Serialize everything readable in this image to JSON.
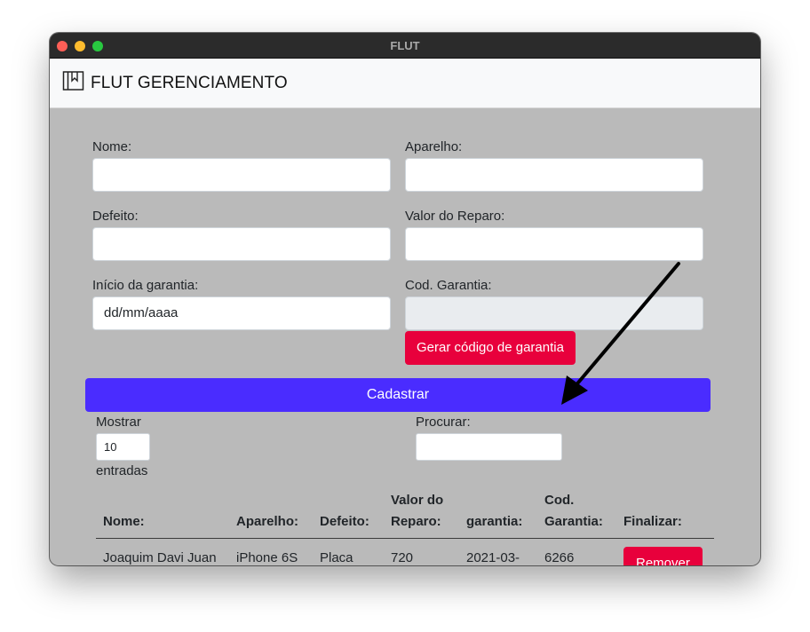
{
  "window": {
    "title": "FLUT"
  },
  "navbar": {
    "brand": "FLUT GERENCIAMENTO"
  },
  "form": {
    "nome_label": "Nome:",
    "aparelho_label": "Aparelho:",
    "defeito_label": "Defeito:",
    "valor_label": "Valor do Reparo:",
    "inicio_label": "Início da garantia:",
    "inicio_value": "dd/mm/aaaa",
    "cod_label": "Cod. Garantia:",
    "gerar_button": "Gerar código de garantia",
    "submit_button": "Cadastrar"
  },
  "table_controls": {
    "mostrar_label": "Mostrar",
    "entries_value": "10",
    "entradas_label": "entradas",
    "procurar_label": "Procurar:"
  },
  "table": {
    "headers": {
      "nome": "Nome:",
      "aparelho": "Aparelho:",
      "defeito": "Defeito:",
      "valor_line1": "Valor do",
      "valor_line2": "Reparo:",
      "garantia": "garantia:",
      "cod_line1": "Cod.",
      "cod_line2": "Garantia:",
      "finalizar": "Finalizar:"
    },
    "rows": [
      {
        "nome": "Joaquim Davi Juan",
        "aparelho": "iPhone 6S",
        "defeito": "Placa",
        "valor": "720",
        "garantia": "2021-03-",
        "cod": "6266",
        "action": "Remover"
      }
    ]
  },
  "colors": {
    "accent_red": "#e8003c",
    "primary_blue": "#4a2cff",
    "content_bg": "#bababa"
  }
}
